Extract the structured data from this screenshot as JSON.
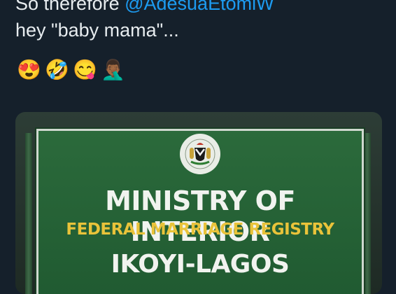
{
  "tweet": {
    "line1_prefix": "So therefore ",
    "mention": "@AdesuaEtomiW",
    "line2": "hey \"baby mama\"...",
    "emojis": [
      {
        "name": "heart-eyes-emoji",
        "glyph": "😍"
      },
      {
        "name": "rolling-laughing-emoji",
        "glyph": "🤣"
      },
      {
        "name": "yum-emoji",
        "glyph": "😋"
      },
      {
        "name": "facepalm-emoji",
        "glyph": "🤦🏾‍♂️"
      }
    ]
  },
  "image": {
    "sign_line1": "MINISTRY OF INTERIOR",
    "sign_line2": "FEDERAL MARRIAGE REGISTRY",
    "sign_line3": "IKOYI-LAGOS"
  },
  "colors": {
    "background": "#15202b",
    "mention": "#1d9bf0",
    "sign_green": "#2b6a3b",
    "sign_yellow": "#e9c33a"
  }
}
